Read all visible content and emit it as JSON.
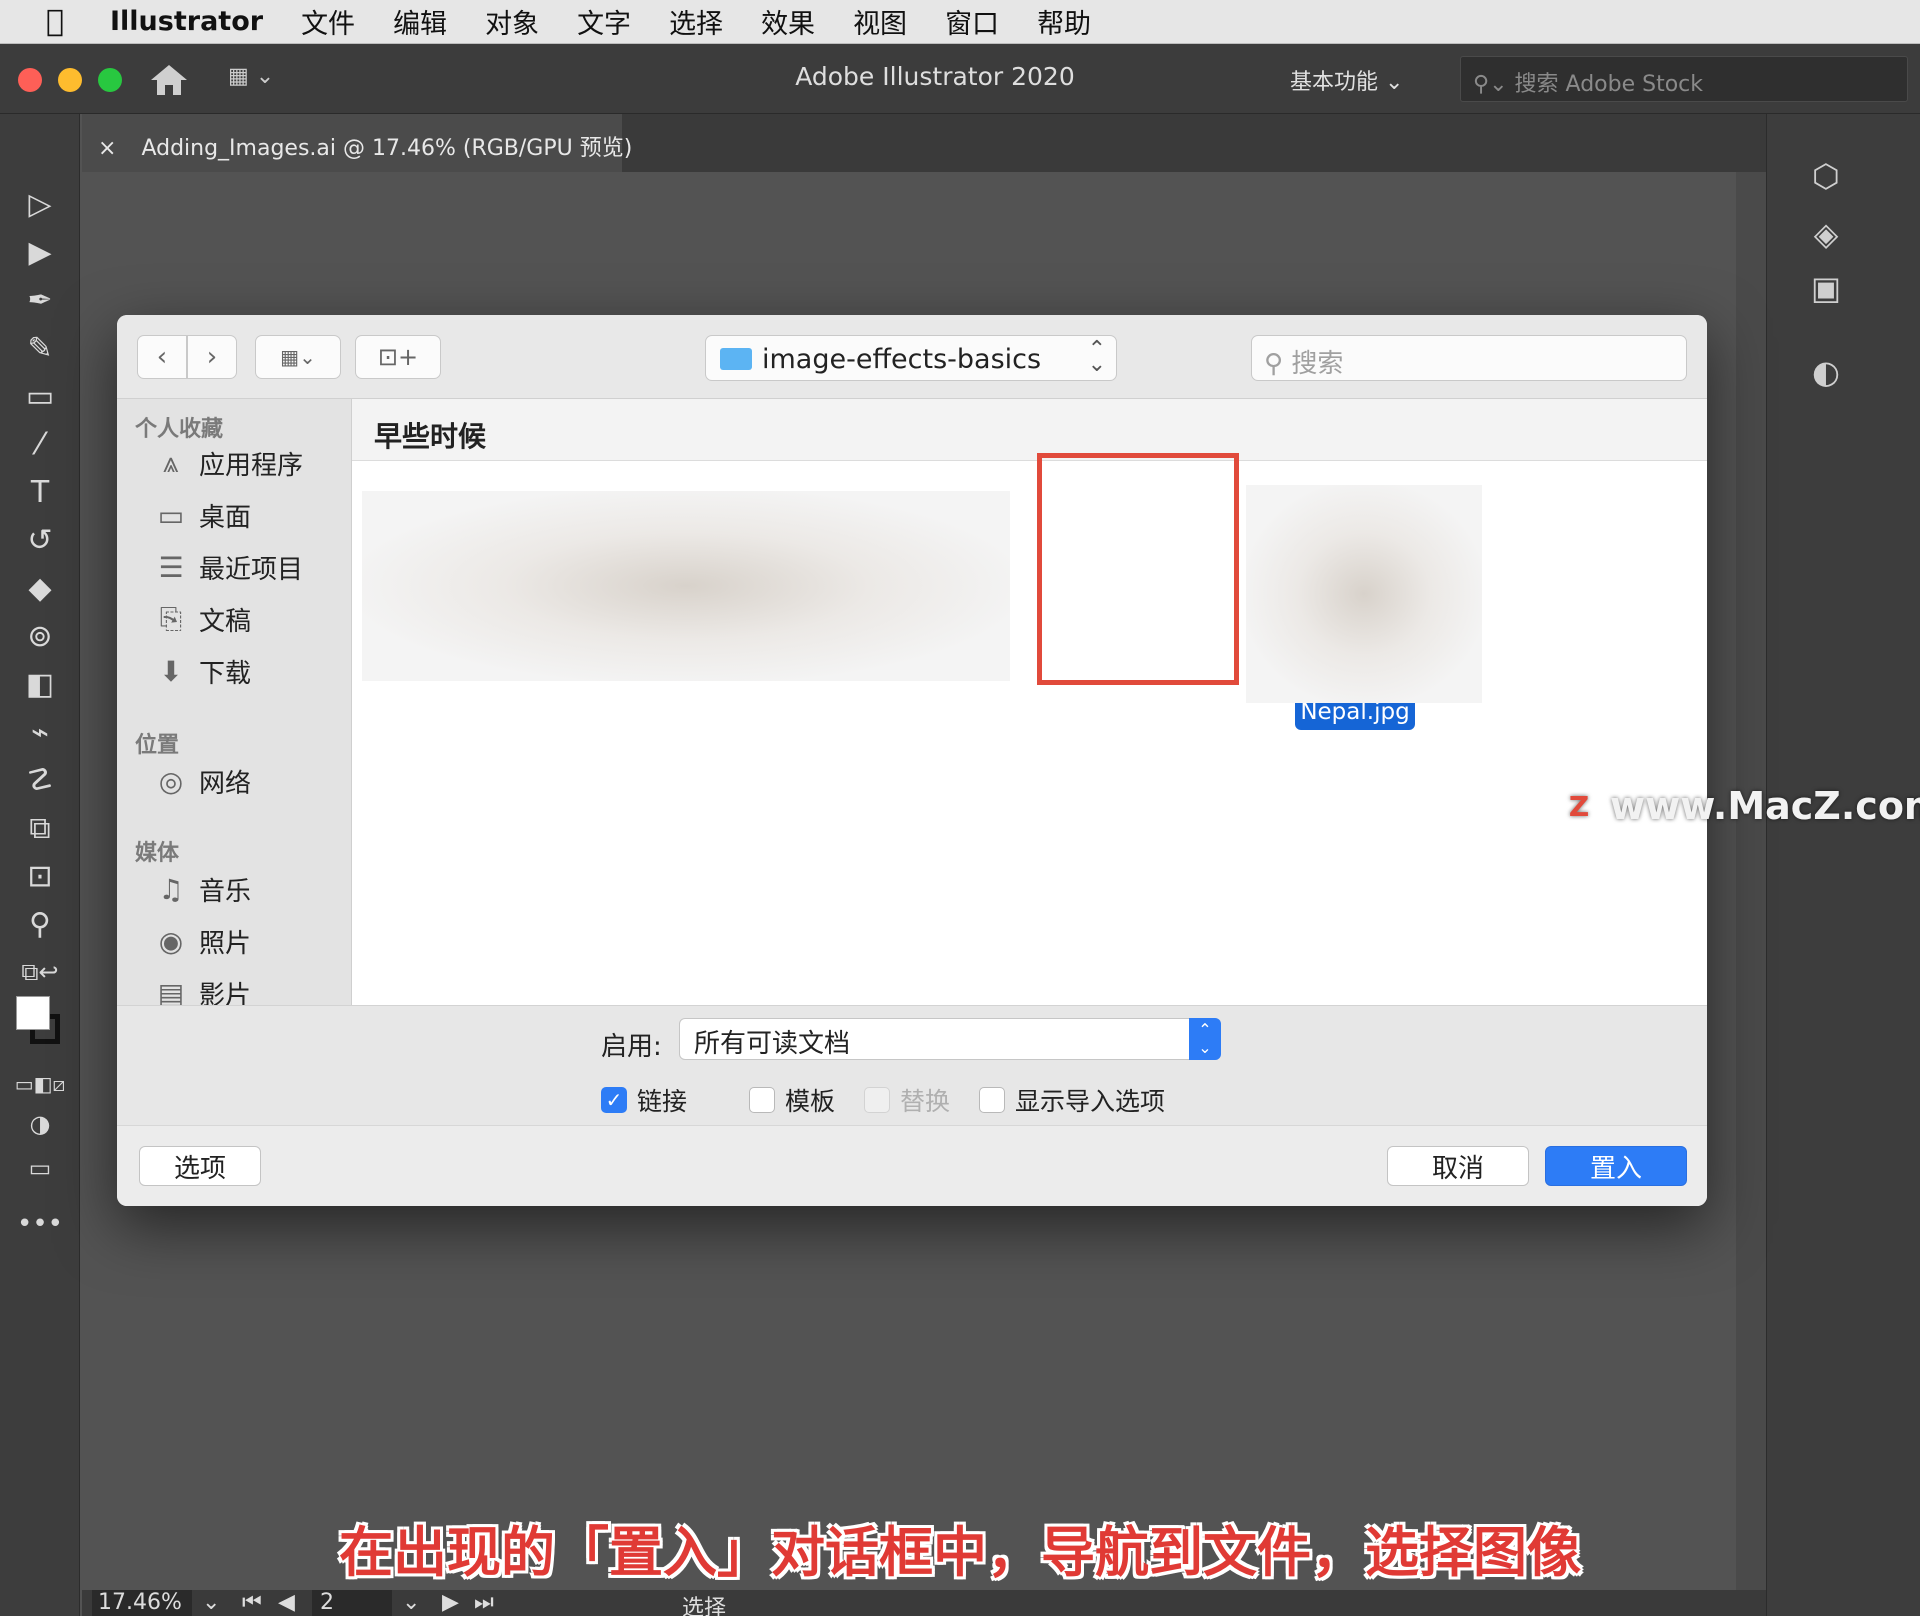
{
  "menubar": {
    "app_name": "Illustrator",
    "items": [
      "文件",
      "编辑",
      "对象",
      "文字",
      "选择",
      "效果",
      "视图",
      "窗口",
      "帮助"
    ]
  },
  "titlebar": {
    "title": "Adobe Illustrator 2020",
    "workspace": "基本功能",
    "stock_search_placeholder": "搜索 Adobe Stock"
  },
  "document_tab": {
    "close": "×",
    "title": "Adding_Images.ai @ 17.46% (RGB/GPU 预览)"
  },
  "dialog": {
    "path": "image-effects-basics",
    "search_placeholder": "搜索",
    "sidebar": {
      "favorites_header": "个人收藏",
      "favorites": [
        {
          "label": "应用程序",
          "icon": "applications-icon"
        },
        {
          "label": "桌面",
          "icon": "desktop-icon"
        },
        {
          "label": "最近项目",
          "icon": "recents-icon"
        },
        {
          "label": "文稿",
          "icon": "documents-icon"
        },
        {
          "label": "下载",
          "icon": "downloads-icon"
        }
      ],
      "locations_header": "位置",
      "locations": [
        {
          "label": "网络",
          "icon": "network-icon"
        }
      ],
      "media_header": "媒体",
      "media": [
        {
          "label": "音乐",
          "icon": "music-icon"
        },
        {
          "label": "照片",
          "icon": "photos-icon"
        },
        {
          "label": "影片",
          "icon": "movies-icon"
        }
      ]
    },
    "section_title": "早些时候",
    "selected_file": "Nepal.jpg",
    "enable_label": "启用:",
    "enable_value": "所有可读文档",
    "checkboxes": [
      {
        "label": "链接",
        "checked": true,
        "disabled": false
      },
      {
        "label": "模板",
        "checked": false,
        "disabled": false
      },
      {
        "label": "替换",
        "checked": false,
        "disabled": true
      },
      {
        "label": "显示导入选项",
        "checked": false,
        "disabled": false
      }
    ],
    "options_button": "选项",
    "cancel_button": "取消",
    "place_button": "置入",
    "accent_color": "#2d7cf6",
    "highlight_color": "#e14a3b"
  },
  "watermark": "www.MacZ.com",
  "caption": "在出现的「置入」对话框中，导航到文件，选择图像",
  "statusbar": {
    "zoom": "17.46%",
    "page": "2",
    "tool_status": "选择"
  }
}
